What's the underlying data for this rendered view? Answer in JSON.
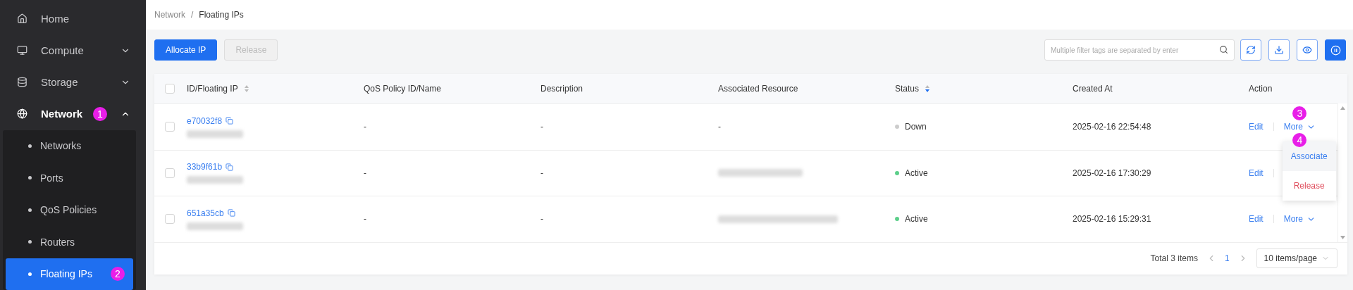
{
  "sidebar": {
    "items": [
      {
        "label": "Home"
      },
      {
        "label": "Compute",
        "expanded": false
      },
      {
        "label": "Storage",
        "expanded": false
      },
      {
        "label": "Network",
        "expanded": true,
        "badge": "1",
        "children": [
          {
            "label": "Networks",
            "selected": false
          },
          {
            "label": "Ports",
            "selected": false
          },
          {
            "label": "QoS Policies",
            "selected": false
          },
          {
            "label": "Routers",
            "selected": false
          },
          {
            "label": "Floating IPs",
            "selected": true,
            "badge": "2"
          }
        ]
      }
    ]
  },
  "breadcrumb": [
    {
      "kind": "link",
      "text": "Network"
    },
    {
      "kind": "separator",
      "text": "/"
    },
    {
      "kind": "current",
      "text": "Floating IPs"
    }
  ],
  "toolbar": {
    "buttons": [
      {
        "label": "Allocate IP",
        "kind": "primary",
        "disabled": false
      },
      {
        "label": "Release",
        "kind": "default",
        "disabled": true
      }
    ],
    "search": {
      "placeholder": "Multiple filter tags are separated by enter"
    },
    "icon_buttons": [
      {
        "selected": false
      },
      {
        "selected": false
      },
      {
        "selected": false
      },
      {
        "selected": true
      }
    ]
  },
  "table": {
    "columns": [
      {
        "label": "ID/Floating IP",
        "sorted": false
      },
      {
        "label": "QoS Policy ID/Name"
      },
      {
        "label": "Description"
      },
      {
        "label": "Associated Resource"
      },
      {
        "label": "Status",
        "sorted": true
      },
      {
        "label": "Created At"
      },
      {
        "label": "Action"
      }
    ],
    "header_checked": false,
    "rows": [
      {
        "checked": false,
        "id": "e70032f8",
        "qos": "-",
        "description": "-",
        "associated": {
          "kind": "text",
          "text": "-"
        },
        "status": {
          "label": "Down",
          "color": "#cccccc"
        },
        "created": "2025-02-16 22:54:48",
        "actions": [
          {
            "label": "Edit",
            "kind": "link"
          },
          {
            "label": "More",
            "kind": "dropdown",
            "open": true,
            "badge": "3",
            "menu": [
              {
                "label": "Associate",
                "kind": "normal",
                "badge": "4"
              },
              {
                "label": "Release",
                "kind": "danger"
              }
            ]
          }
        ]
      },
      {
        "checked": false,
        "id": "33b9f61b",
        "qos": "-",
        "description": "-",
        "associated": {
          "kind": "blurred"
        },
        "status": {
          "label": "Active",
          "color": "#5ccf8a"
        },
        "created": "2025-02-16 17:30:29",
        "actions": [
          {
            "label": "Edit",
            "kind": "link"
          }
        ]
      },
      {
        "checked": false,
        "id": "651a35cb",
        "qos": "-",
        "description": "-",
        "associated": {
          "kind": "blurred"
        },
        "status": {
          "label": "Active",
          "color": "#5ccf8a"
        },
        "created": "2025-02-16 15:29:31",
        "actions": [
          {
            "label": "Edit",
            "kind": "link"
          },
          {
            "label": "More",
            "kind": "dropdown"
          }
        ]
      }
    ]
  },
  "pagination": {
    "total": "Total 3 items",
    "pages": [
      {
        "label": "1",
        "selected": true
      }
    ],
    "page_size": "10 items/page"
  }
}
